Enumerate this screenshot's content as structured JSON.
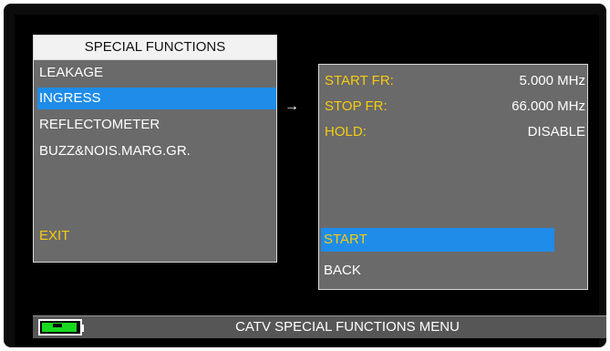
{
  "menu": {
    "title": "SPECIAL FUNCTIONS",
    "items": [
      {
        "label": "LEAKAGE"
      },
      {
        "label": "INGRESS"
      },
      {
        "label": "REFLECTOMETER"
      },
      {
        "label": "BUZZ&NOIS.MARG.GR."
      }
    ],
    "exit_label": "EXIT"
  },
  "arrow": "→",
  "settings": {
    "rows": [
      {
        "label": "START FR:",
        "value": "5.000 MHz"
      },
      {
        "label": "STOP FR:",
        "value": "66.000 MHz"
      },
      {
        "label": "HOLD:",
        "value": "DISABLE"
      }
    ],
    "actions": [
      {
        "label": "START"
      },
      {
        "label": "BACK"
      }
    ]
  },
  "status_bar": {
    "title": "CATV SPECIAL FUNCTIONS MENU"
  },
  "colors": {
    "accent": "#1e8ce8",
    "highlight_text": "#f5cc10",
    "battery": "#18d91f"
  }
}
